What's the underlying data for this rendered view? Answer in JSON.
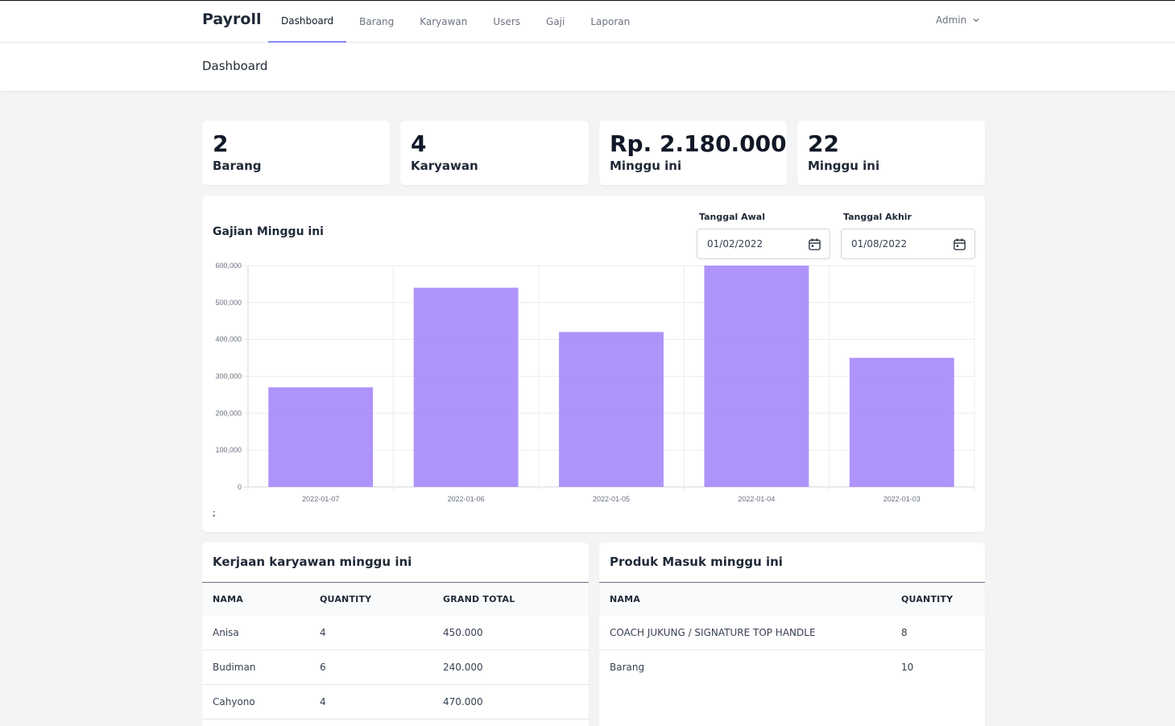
{
  "nav": {
    "brand": "Payroll",
    "items": [
      {
        "label": "Dashboard",
        "active": true
      },
      {
        "label": "Barang"
      },
      {
        "label": "Karyawan"
      },
      {
        "label": "Users"
      },
      {
        "label": "Gaji"
      },
      {
        "label": "Laporan"
      }
    ],
    "user": "Admin"
  },
  "header": {
    "title": "Dashboard"
  },
  "stats": [
    {
      "value": "2",
      "label": "Barang"
    },
    {
      "value": "4",
      "label": "Karyawan"
    },
    {
      "value": "Rp. 2.180.000",
      "label": "Minggu ini"
    },
    {
      "value": "22",
      "label": "Minggu ini"
    }
  ],
  "chart_card": {
    "title": "Gajian Minggu ini",
    "start_label": "Tanggal Awal",
    "start_value": "01/02/2022",
    "end_label": "Tanggal Akhir",
    "end_value": "01/08/2022",
    "footnote": ";"
  },
  "chart_data": {
    "type": "bar",
    "categories": [
      "2022-01-07",
      "2022-01-06",
      "2022-01-05",
      "2022-01-04",
      "2022-01-03"
    ],
    "values": [
      270000,
      540000,
      420000,
      600000,
      350000
    ],
    "ylim": [
      0,
      600000
    ],
    "yticks": [
      "0",
      "100,000",
      "200,000",
      "300,000",
      "400,000",
      "500,000",
      "600,000"
    ],
    "grid": true,
    "bar_color": "#a78bfa"
  },
  "work_table": {
    "title": "Kerjaan karyawan minggu ini",
    "headers": [
      "NAMA",
      "QUANTITY",
      "GRAND TOTAL"
    ],
    "rows": [
      [
        "Anisa",
        "4",
        "450.000"
      ],
      [
        "Budiman",
        "6",
        "240.000"
      ],
      [
        "Cahyono",
        "4",
        "470.000"
      ]
    ]
  },
  "product_table": {
    "title": "Produk Masuk minggu ini",
    "headers": [
      "NAMA",
      "QUANTITY"
    ],
    "rows": [
      [
        "COACH JUKUNG / SIGNATURE TOP HANDLE",
        "8"
      ],
      [
        "Barang",
        "10"
      ]
    ]
  }
}
